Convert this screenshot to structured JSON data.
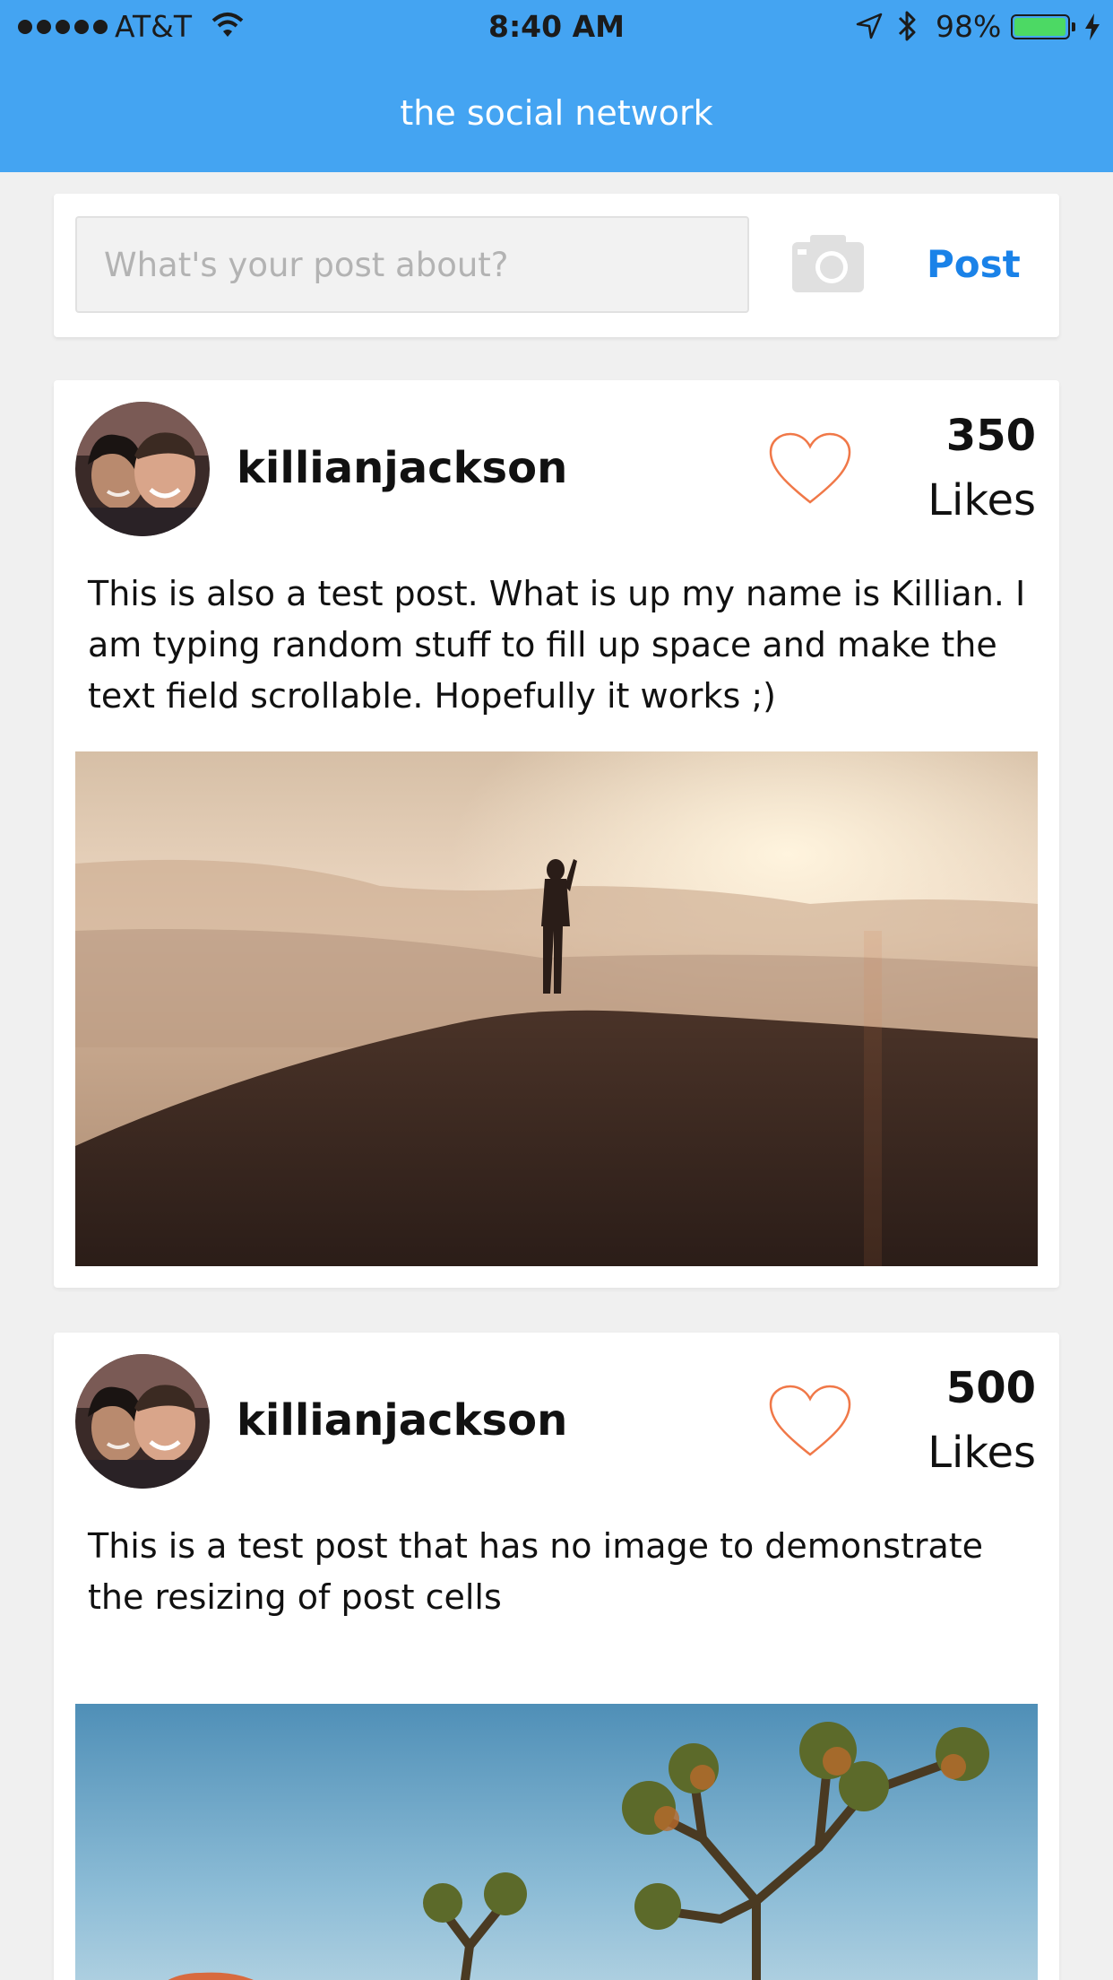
{
  "status_bar": {
    "carrier": "AT&T",
    "time": "8:40 AM",
    "battery": "98%",
    "battery_level": 0.98
  },
  "nav": {
    "title": "the social network"
  },
  "composer": {
    "placeholder": "What's your post about?",
    "post_label": "Post"
  },
  "posts": [
    {
      "username": "killianjackson",
      "likes": "350",
      "likes_label": "Likes",
      "text": "This is also a test post. What is up my name is Killian. I am typing random stuff to fill up space and make the text field scrollable. Hopefully it works ;)"
    },
    {
      "username": "killianjackson",
      "likes": "500",
      "likes_label": "Likes",
      "text": "This is a test post that has no image to demonstrate the resizing of post cells"
    }
  ],
  "colors": {
    "nav_bg": "#44a4f2",
    "post_button": "#1a82e8",
    "heart": "#f07848",
    "battery": "#4cd964"
  }
}
